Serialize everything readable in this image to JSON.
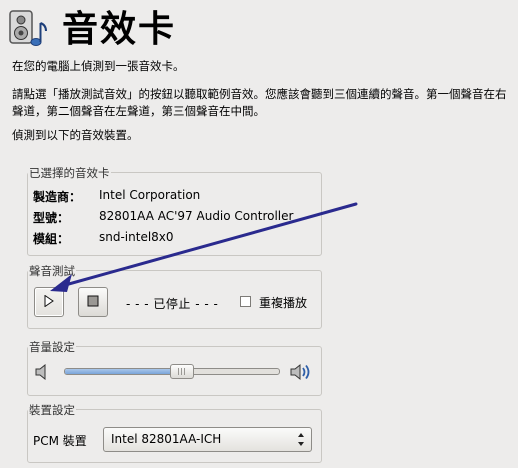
{
  "header": {
    "title": "音效卡"
  },
  "intro": {
    "detected": "在您的電腦上偵測到一張音效卡。",
    "instructions": "請點選「播放測試音效」的按鈕以聽取範例音效。您應該會聽到三個連續的聲音。第一個聲音在右聲道，第二個聲音在左聲道，第三個聲音在中間。",
    "devices_heading": "偵測到以下的音效裝置。"
  },
  "selected_card": {
    "label": "已選擇的音效卡",
    "vendor_key": "製造商：",
    "vendor_value": "Intel Corporation",
    "model_key": "型號：",
    "model_value": "82801AA AC'97 Audio Controller",
    "module_key": "模組：",
    "module_value": "snd-intel8x0"
  },
  "sound_test": {
    "label": "聲音測試",
    "status": "- - - 已停止 - - -",
    "repeat_label": "重複播放",
    "repeat_checked": false
  },
  "volume": {
    "label": "音量設定",
    "level": 0.55
  },
  "device": {
    "label": "裝置設定",
    "pcm_label": "PCM 裝置",
    "pcm_value": "Intel 82801AA-ICH"
  },
  "colors": {
    "annotation_arrow": "#2a2a8e",
    "slider_fill": "#7aa4d8"
  },
  "icons": {
    "app": "sound-card-speaker-icon",
    "play": "play-icon",
    "stop": "stop-icon",
    "volume_low": "speaker-low-icon",
    "volume_high": "speaker-high-icon",
    "select": "updown-arrows-icon"
  }
}
